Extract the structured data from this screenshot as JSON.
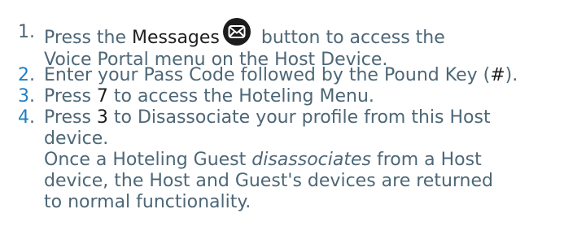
{
  "steps": [
    {
      "number": "1",
      "before": "Press the ",
      "highlight": "Messages",
      "after": " button to access the",
      "line2": "Voice Portal menu on the Host Device."
    },
    {
      "number": "2",
      "text": "Enter your Pass Code followed by the Pound Key (",
      "highlight": "#",
      "after": ")."
    },
    {
      "number": "3",
      "before": "Press ",
      "highlight": "7",
      "after": " to access the Hoteling Menu."
    },
    {
      "number": "4",
      "before": "Press ",
      "highlight": "3",
      "after": " to Disassociate your profile from this Host",
      "line2": "device.",
      "note_line1_before": "Once a Hoteling Guest ",
      "note_line1_em": "disassociates",
      "note_line1_after": " from a Host",
      "note_line2": "device, the Host and Guest's devices are returned",
      "note_line3": "to normal functionality."
    }
  ],
  "icons": {
    "messages_button": "envelope-icon"
  },
  "colors": {
    "text": "#4d6777",
    "number_blue": "#1f7fc4",
    "highlight_black": "#1e1e1e",
    "icon_bg": "#1c1c1c"
  }
}
